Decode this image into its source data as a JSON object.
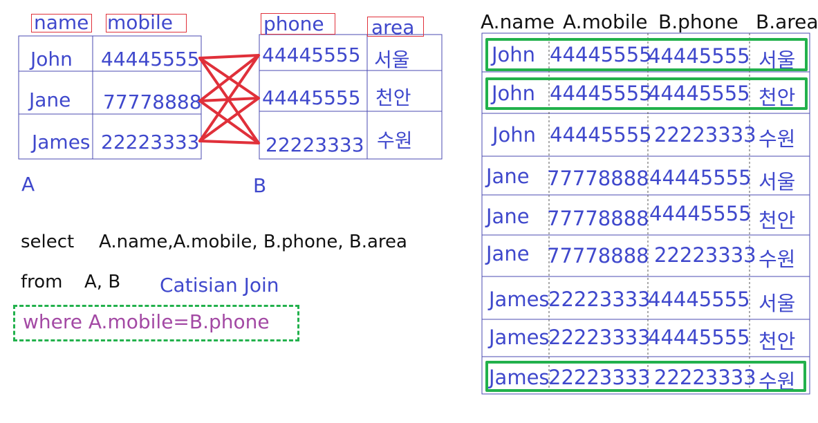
{
  "tableA": {
    "caption": "A",
    "headers": [
      "name",
      "mobile"
    ],
    "rows": [
      [
        "John",
        "44445555"
      ],
      [
        "Jane",
        "77778888"
      ],
      [
        "James",
        "22223333"
      ]
    ]
  },
  "tableB": {
    "caption": "B",
    "headers": [
      "phone",
      "area"
    ],
    "rows": [
      [
        "44445555",
        "서울"
      ],
      [
        "44445555",
        "천안"
      ],
      [
        "22223333",
        "수원"
      ]
    ]
  },
  "query": {
    "select": "select",
    "select_cols": "A.name,A.mobile, B.phone, B.area",
    "from": "from",
    "from_tables": "A, B",
    "join_note": "Catisian Join",
    "where": "where A.mobile=B.phone"
  },
  "result": {
    "headers": [
      "A.name",
      "A.mobile",
      "B.phone",
      "B.area"
    ],
    "rows": [
      [
        "John",
        "44445555",
        "44445555",
        "서울"
      ],
      [
        "John",
        "44445555",
        "44445555",
        "천안"
      ],
      [
        "John",
        "44445555",
        "22223333",
        "수원"
      ],
      [
        "Jane",
        "77778888",
        "44445555",
        "서울"
      ],
      [
        "Jane",
        "77778888",
        "44445555",
        "천안"
      ],
      [
        "Jane",
        "77778888",
        "22223333",
        "수원"
      ],
      [
        "James",
        "22223333",
        "44445555",
        "서울"
      ],
      [
        "James",
        "22223333",
        "44445555",
        "천안"
      ],
      [
        "James",
        "22223333",
        "22223333",
        "수원"
      ]
    ],
    "highlighted_rows": [
      0,
      1,
      8
    ]
  },
  "colors": {
    "text_blue": "#3f48cc",
    "grid": "#4a4ab0",
    "connector_red": "#e0303a",
    "highlight_green": "#22b14c",
    "where_purple": "#a349a4"
  }
}
